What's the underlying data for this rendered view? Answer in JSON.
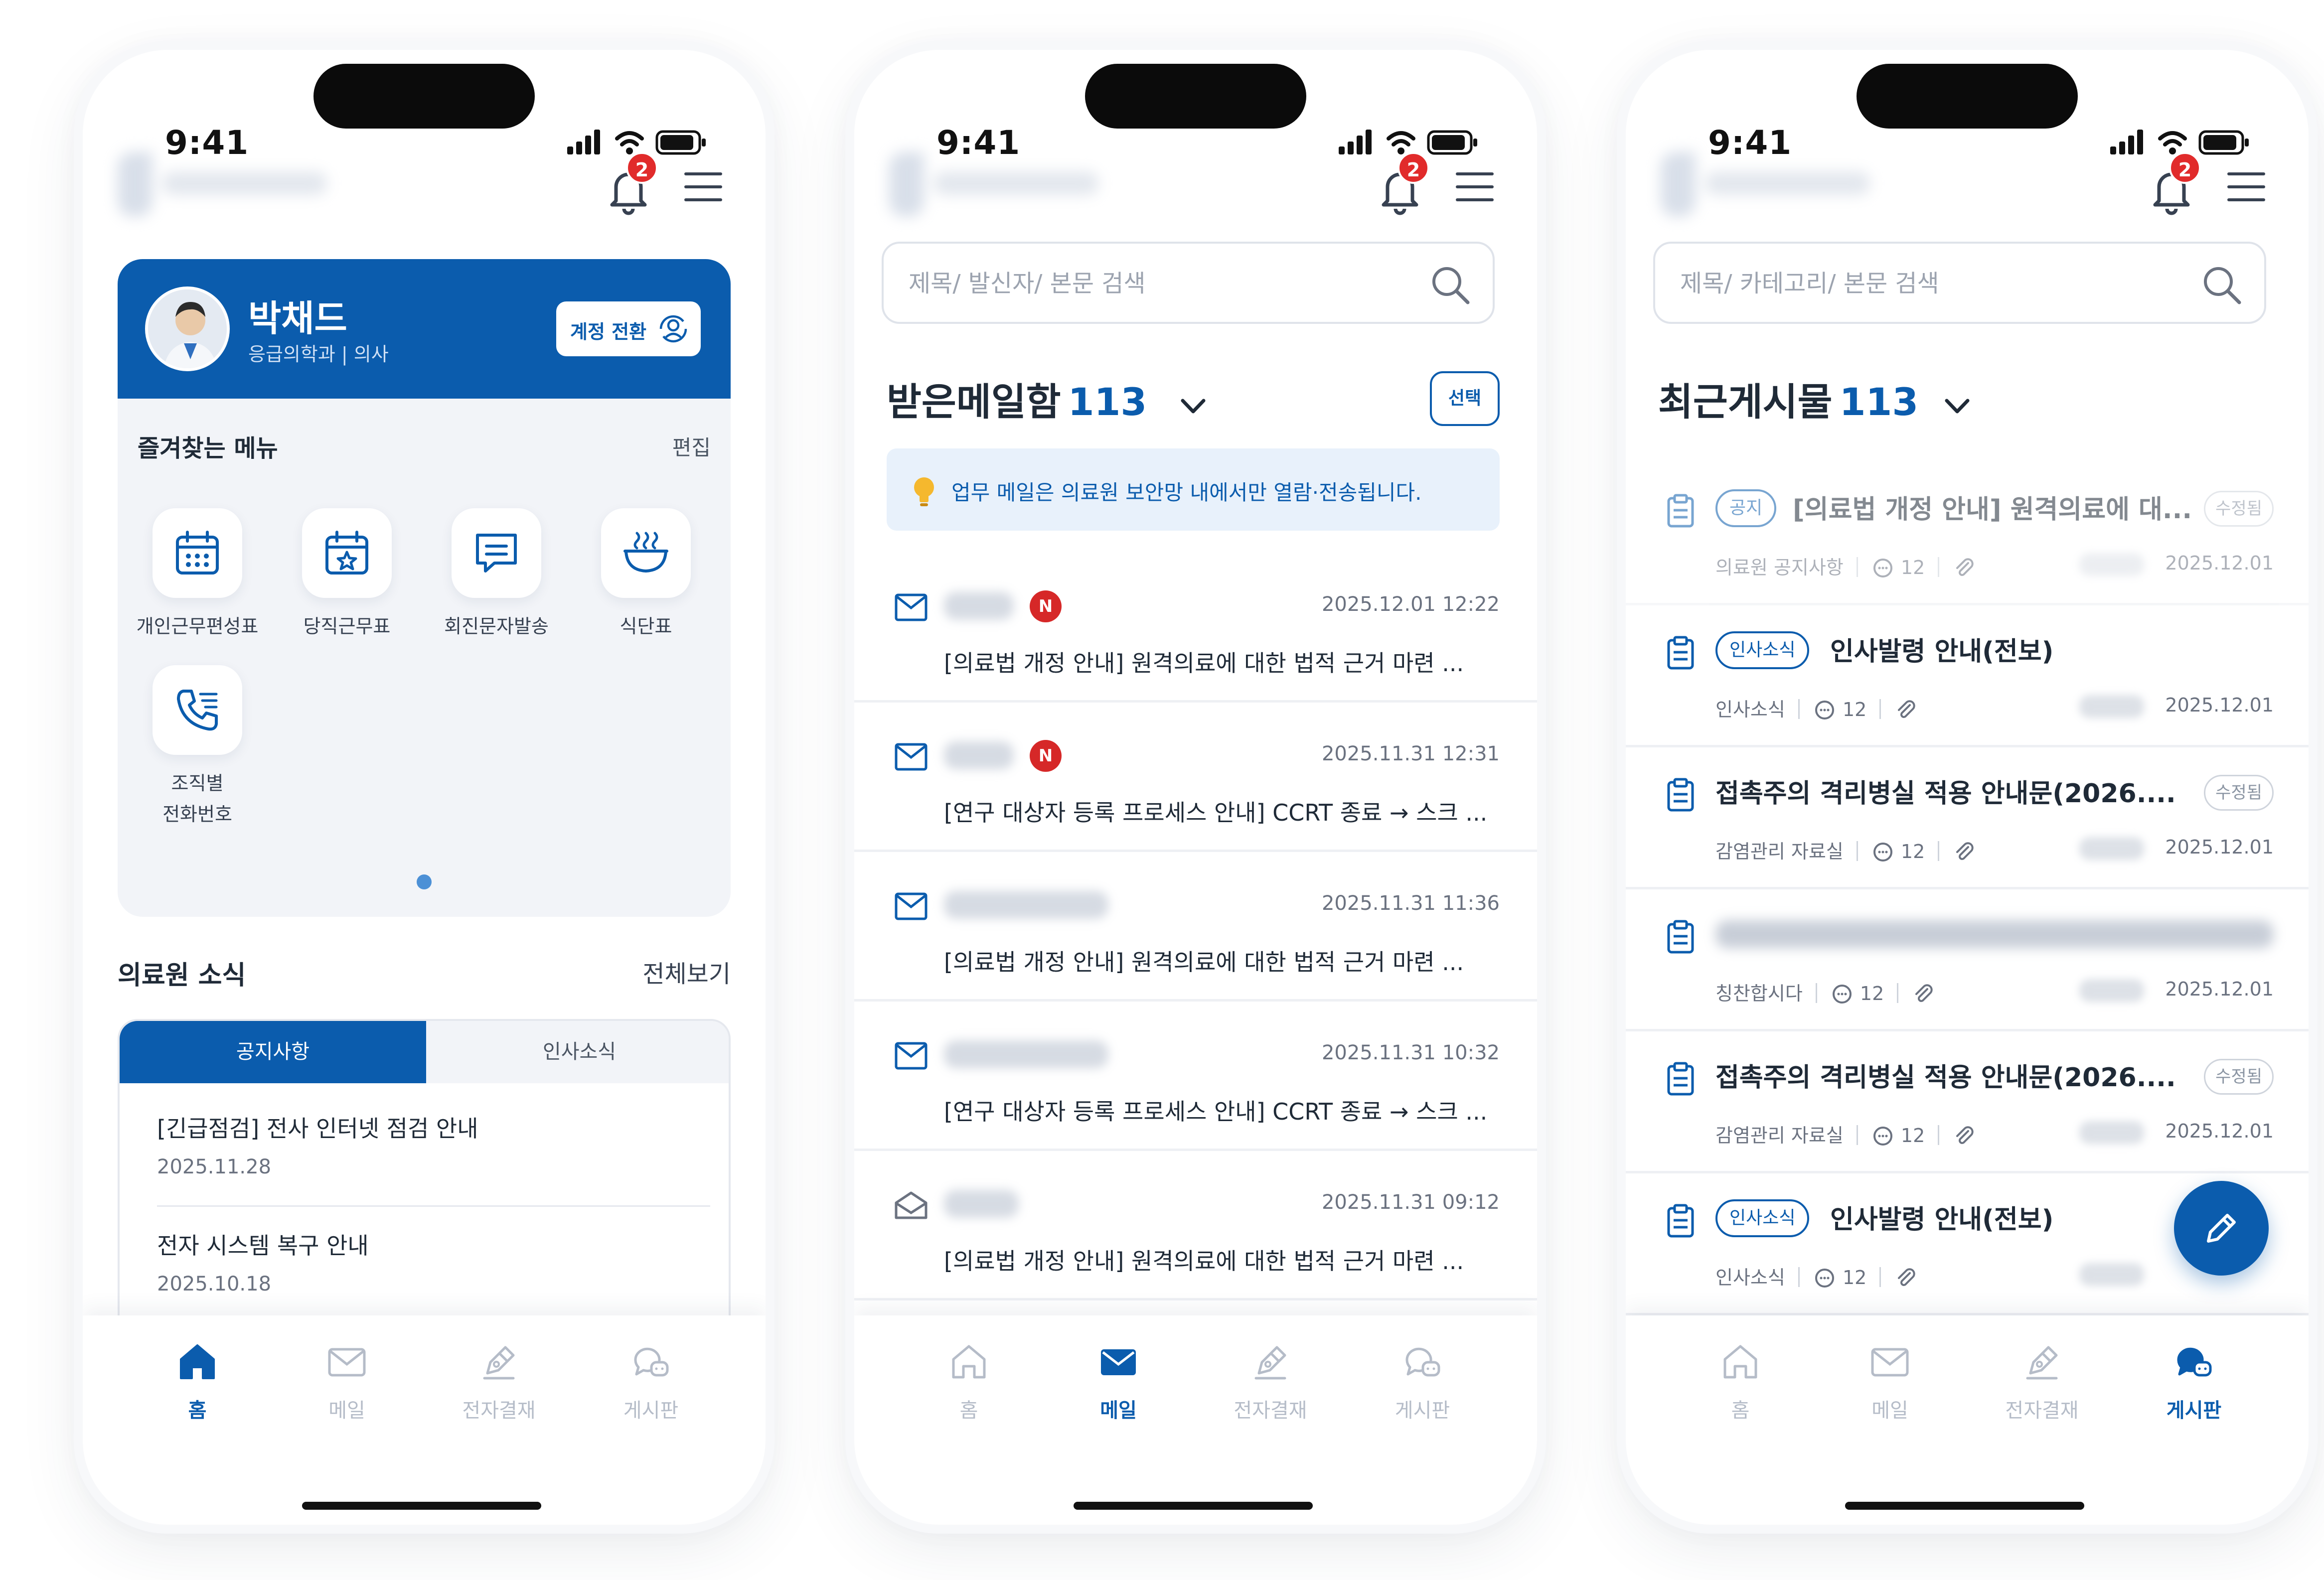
{
  "status_bar": {
    "time": "9:41"
  },
  "header": {
    "notification_count": "2"
  },
  "home": {
    "profile": {
      "name": "박채드",
      "department": "응급의학과 | 의사",
      "switch_label": "계정 전환"
    },
    "favorites": {
      "title": "즐겨찾는 메뉴",
      "edit_label": "편집",
      "items": [
        {
          "label": "개인근무편성표",
          "icon": "calendar-icon"
        },
        {
          "label": "당직근무표",
          "icon": "calendar-star-icon"
        },
        {
          "label": "회진문자발송",
          "icon": "message-icon"
        },
        {
          "label": "식단표",
          "icon": "meal-icon"
        },
        {
          "label_line1": "조직별",
          "label_line2": "전화번호",
          "icon": "phone-icon"
        }
      ]
    },
    "news": {
      "title": "의료원 소식",
      "view_all": "전체보기",
      "tabs": [
        "공지사항",
        "인사소식"
      ],
      "items": [
        {
          "title": "[긴급점검] 전사 인터넷 점검 안내",
          "date": "2025.11.28"
        },
        {
          "title": "전자 시스템 복구 안내",
          "date": "2025.10.18"
        }
      ]
    }
  },
  "mail": {
    "search_placeholder": "제목/ 발신자/ 본문 검색",
    "box_title": "받은메일함",
    "count": "113",
    "select_label": "선택",
    "notice": "업무 메일은 의료원 보안망 내에서만 열람·전송됩니다.",
    "new_badge": "N",
    "items": [
      {
        "date": "2025.12.01 12:22",
        "subject": "[의료법 개정 안내] 원격의료에 대한 법적 근거 마련 ..."
      },
      {
        "date": "2025.11.31 12:31",
        "subject": "[연구 대상자 등록 프로세스 안내] CCRT 종료 → 스크 ..."
      },
      {
        "date": "2025.11.31 11:36",
        "subject": "[의료법 개정 안내] 원격의료에 대한 법적 근거 마련 ..."
      },
      {
        "date": "2025.11.31 10:32",
        "subject": "[연구 대상자 등록 프로세스 안내] CCRT 종료 → 스크 ..."
      },
      {
        "date": "2025.11.31 09:12",
        "subject": "[의료법 개정 안내] 원격의료에 대한 법적 근거 마련 ..."
      }
    ]
  },
  "board": {
    "search_placeholder": "제목/ 카테고리/ 본문 검색",
    "title": "최근게시물",
    "count": "113",
    "modified_label": "수정됨",
    "items": [
      {
        "tag": "공지",
        "title": "[의료법 개정 안내] 원격의료에 대...",
        "category": "의료원 공지사항",
        "comments": "12",
        "date": "2025.12.01"
      },
      {
        "tag": "인사소식",
        "title": "인사발령 안내(전보)",
        "category": "인사소식",
        "comments": "12",
        "date": "2025.12.01"
      },
      {
        "tag": "",
        "title": "접촉주의 격리병실 적용 안내문(2026....",
        "category": "감염관리 자료실",
        "comments": "12",
        "date": "2025.12.01"
      },
      {
        "tag": "",
        "title": "",
        "category": "칭찬합시다",
        "comments": "12",
        "date": "2025.12.01"
      },
      {
        "tag": "",
        "title": "접촉주의 격리병실 적용 안내문(2026....",
        "category": "감염관리 자료실",
        "comments": "12",
        "date": "2025.12.01"
      },
      {
        "tag": "인사소식",
        "title": "인사발령 안내(전보)",
        "category": "인사소식",
        "comments": "12",
        "date": ""
      }
    ]
  },
  "tabbar": {
    "home": "홈",
    "mail": "메일",
    "approval": "전자결재",
    "board": "게시판"
  },
  "colors": {
    "primary": "#0b5cad",
    "badge_red": "#e12b2b",
    "inactive": "#b5bcc8",
    "card_bg": "#f2f4f8"
  }
}
